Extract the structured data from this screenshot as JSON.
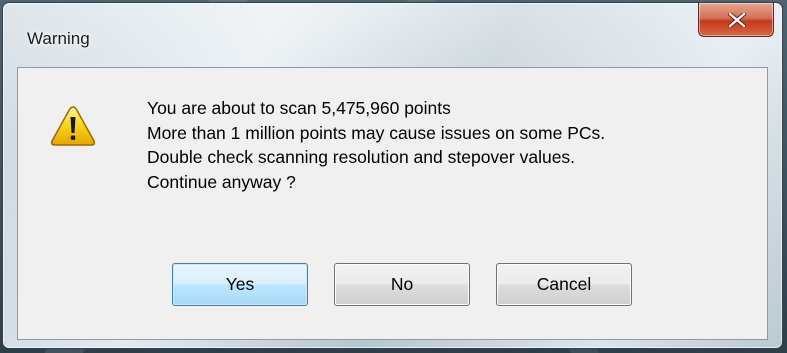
{
  "window": {
    "title": "Warning",
    "close_label": "close"
  },
  "message": {
    "lines": [
      "You are about to scan 5,475,960 points",
      "More than 1 million points may cause issues on some PCs.",
      "Double check scanning resolution and stepover values.",
      "Continue anyway ?"
    ]
  },
  "buttons": {
    "yes": "Yes",
    "no": "No",
    "cancel": "Cancel"
  },
  "icons": {
    "warning": "warning-triangle-icon",
    "close": "close-x-icon"
  },
  "colors": {
    "close_button": "#c5391c",
    "default_button_border": "#3c7fb1",
    "warning_yellow": "#f5c400"
  }
}
